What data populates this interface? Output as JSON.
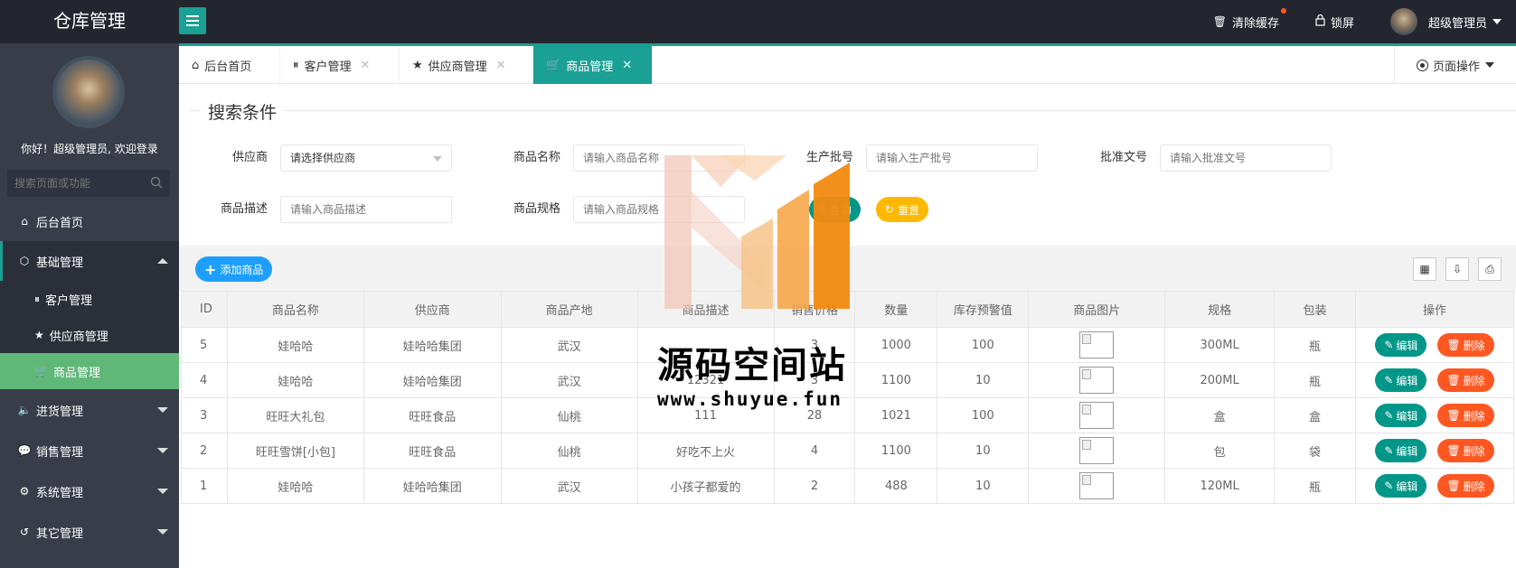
{
  "app": {
    "title": "仓库管理"
  },
  "topbar": {
    "clear_cache": "清除缓存",
    "lock_screen": "锁屏",
    "user_name": "超级管理员"
  },
  "sidebar": {
    "welcome": "你好！超级管理员, 欢迎登录",
    "search_placeholder": "搜索页面或功能",
    "items": [
      {
        "label": "后台首页",
        "icon": "home-icon"
      },
      {
        "label": "基础管理",
        "icon": "cube-icon"
      },
      {
        "label": "客户管理",
        "icon": "pause-circle-icon"
      },
      {
        "label": "供应商管理",
        "icon": "star-icon"
      },
      {
        "label": "商品管理",
        "icon": "cart-icon"
      },
      {
        "label": "进货管理",
        "icon": "speaker-icon"
      },
      {
        "label": "销售管理",
        "icon": "chat-icon"
      },
      {
        "label": "系统管理",
        "icon": "gear-icon"
      },
      {
        "label": "其它管理",
        "icon": "exit-icon"
      }
    ]
  },
  "tabs": [
    {
      "label": "后台首页"
    },
    {
      "label": "客户管理"
    },
    {
      "label": "供应商管理"
    },
    {
      "label": "商品管理"
    }
  ],
  "page_ops": "页面操作",
  "search": {
    "legend": "搜索条件",
    "supplier_label": "供应商",
    "supplier_value": "请选择供应商",
    "name_label": "商品名称",
    "name_placeholder": "请输入商品名称",
    "batch_label": "生产批号",
    "batch_placeholder": "请输入生产批号",
    "approval_label": "批准文号",
    "approval_placeholder": "请输入批准文号",
    "desc_label": "商品描述",
    "desc_placeholder": "请输入商品描述",
    "spec_label": "商品规格",
    "spec_placeholder": "请输入商品规格",
    "search_button": "查询",
    "reset_button": "重置"
  },
  "toolbar": {
    "add_button": "添加商品"
  },
  "table": {
    "headers": [
      "ID",
      "商品名称",
      "供应商",
      "商品产地",
      "商品描述",
      "销售价格",
      "数量",
      "库存预警值",
      "商品图片",
      "规格",
      "包装",
      "操作"
    ],
    "edit_label": "编辑",
    "delete_label": "删除",
    "rows": [
      {
        "id": "5",
        "name": "娃哈哈",
        "supplier": "娃哈哈集团",
        "origin": "武汉",
        "desc": "",
        "price": "3",
        "qty": "1000",
        "warn": "100",
        "spec": "300ML",
        "pack": "瓶"
      },
      {
        "id": "4",
        "name": "娃哈哈",
        "supplier": "娃哈哈集团",
        "origin": "武汉",
        "desc": "12321",
        "price": "3",
        "qty": "1100",
        "warn": "10",
        "spec": "200ML",
        "pack": "瓶"
      },
      {
        "id": "3",
        "name": "旺旺大礼包",
        "supplier": "旺旺食品",
        "origin": "仙桃",
        "desc": "111",
        "price": "28",
        "qty": "1021",
        "warn": "100",
        "spec": "盒",
        "pack": "盒"
      },
      {
        "id": "2",
        "name": "旺旺雪饼[小包]",
        "supplier": "旺旺食品",
        "origin": "仙桃",
        "desc": "好吃不上火",
        "price": "4",
        "qty": "1100",
        "warn": "10",
        "spec": "包",
        "pack": "袋"
      },
      {
        "id": "1",
        "name": "娃哈哈",
        "supplier": "娃哈哈集团",
        "origin": "武汉",
        "desc": "小孩子都爱的",
        "price": "2",
        "qty": "488",
        "warn": "10",
        "spec": "120ML",
        "pack": "瓶"
      }
    ]
  },
  "watermark": {
    "text": "源码空间站",
    "url": "www.shuyue.fun"
  },
  "colors": {
    "accent": "#1aa094",
    "active_menu": "#5fb878",
    "add": "#1e9fff",
    "delete": "#ff5722",
    "reset": "#ffb800"
  }
}
